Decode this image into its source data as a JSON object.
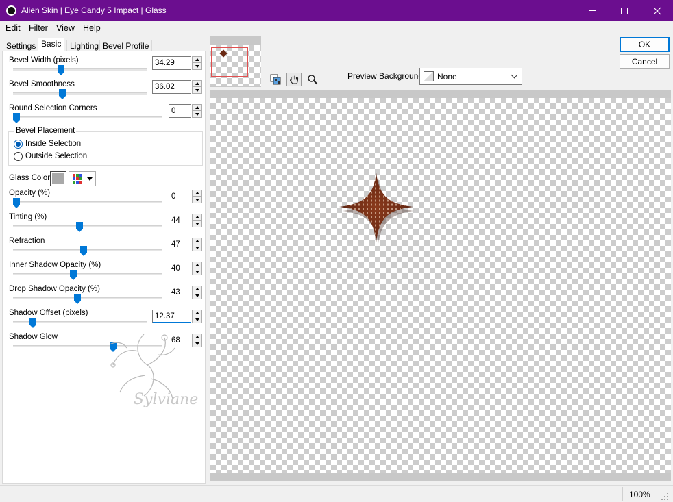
{
  "window": {
    "title": "Alien Skin | Eye Candy 5 Impact | Glass",
    "minimize": "minimize",
    "maximize": "maximize",
    "close": "close"
  },
  "menu": [
    {
      "label": "Edit",
      "mnemonic": "E"
    },
    {
      "label": "Filter",
      "mnemonic": "F"
    },
    {
      "label": "View",
      "mnemonic": "V"
    },
    {
      "label": "Help",
      "mnemonic": "H"
    }
  ],
  "tabs": [
    "Settings",
    "Basic",
    "Lighting",
    "Bevel Profile"
  ],
  "active_tab": "Basic",
  "params": {
    "bevel_width": {
      "label": "Bevel Width (pixels)",
      "value": "34.29",
      "level": 0.35
    },
    "bevel_smoothness": {
      "label": "Bevel Smoothness",
      "value": "36.02",
      "level": 0.36
    },
    "round_corners": {
      "label": "Round Selection Corners",
      "value": "0",
      "level": 0.0
    },
    "opacity": {
      "label": "Opacity (%)",
      "value": "0",
      "level": 0.0
    },
    "tinting": {
      "label": "Tinting (%)",
      "value": "44",
      "level": 0.44
    },
    "refraction": {
      "label": "Refraction",
      "value": "47",
      "level": 0.47
    },
    "inner_shadow": {
      "label": "Inner Shadow Opacity (%)",
      "value": "40",
      "level": 0.4
    },
    "drop_shadow": {
      "label": "Drop Shadow Opacity (%)",
      "value": "43",
      "level": 0.43
    },
    "shadow_offset": {
      "label": "Shadow Offset (pixels)",
      "value": "12.37",
      "level": 0.13
    },
    "shadow_glow": {
      "label": "Shadow Glow",
      "value": "68",
      "level": 0.68
    }
  },
  "bevel_placement": {
    "title": "Bevel Placement",
    "options": [
      "Inside Selection",
      "Outside Selection"
    ],
    "selected": "Inside Selection"
  },
  "glass_color": {
    "label": "Glass Color",
    "color": "#a9a9a9"
  },
  "preview_background": {
    "label": "Preview Background:",
    "value": "None"
  },
  "buttons": {
    "ok": "OK",
    "cancel": "Cancel"
  },
  "tools": [
    "preview-toggle-icon",
    "hand-icon",
    "zoom-icon"
  ],
  "status": {
    "zoom": "100%"
  },
  "watermark": {
    "text": "Sylviane"
  },
  "colors": {
    "titlebar": "#6b0e8f",
    "accent": "#0078d7",
    "shape": "#6b2a14"
  }
}
